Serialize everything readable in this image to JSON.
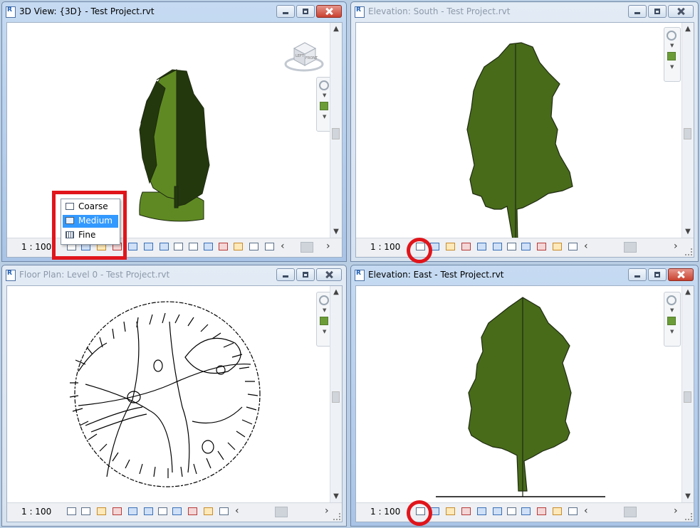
{
  "windows": {
    "view3d": {
      "title": "3D View: {3D} - Test Project.rvt",
      "scale": "1 : 100"
    },
    "south": {
      "title": "Elevation: South - Test Project.rvt",
      "scale": "1 : 100"
    },
    "floor": {
      "title": "Floor Plan: Level 0 - Test Project.rvt",
      "scale": "1 : 100"
    },
    "east": {
      "title": "Elevation: East - Test Project.rvt",
      "scale": "1 : 100"
    }
  },
  "detail_level_menu": {
    "items": [
      {
        "label": "Coarse",
        "selected": false
      },
      {
        "label": "Medium",
        "selected": true
      },
      {
        "label": "Fine",
        "selected": false
      }
    ]
  },
  "viewcube": {
    "face_label": "FRONT",
    "side_label": "LEFT"
  },
  "colors": {
    "tree_green": "#486b1a",
    "tree_dark": "#23380d",
    "tree_light": "#5f8a23",
    "highlight_red": "#e0151b",
    "menu_selected": "#3399ff"
  }
}
